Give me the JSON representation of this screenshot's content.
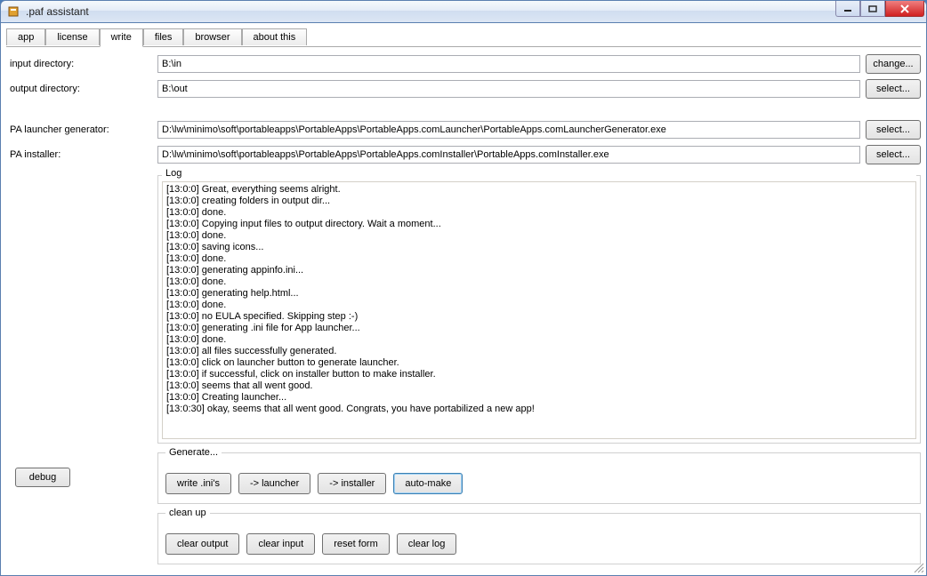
{
  "window": {
    "title": ".paf assistant"
  },
  "tabs": [
    {
      "label": "app"
    },
    {
      "label": "license"
    },
    {
      "label": "write"
    },
    {
      "label": "files"
    },
    {
      "label": "browser"
    },
    {
      "label": "about this"
    }
  ],
  "fields": {
    "input_dir": {
      "label": "input directory:",
      "value": "B:\\in",
      "button": "change..."
    },
    "output_dir": {
      "label": "output directory:",
      "value": "B:\\out",
      "button": "select..."
    },
    "launcher_gen": {
      "label": "PA launcher generator:",
      "value": "D:\\lw\\minimo\\soft\\portableapps\\PortableApps\\PortableApps.comLauncher\\PortableApps.comLauncherGenerator.exe",
      "button": "select..."
    },
    "installer": {
      "label": "PA installer:",
      "value": "D:\\lw\\minimo\\soft\\portableapps\\PortableApps\\PortableApps.comInstaller\\PortableApps.comInstaller.exe",
      "button": "select..."
    }
  },
  "log": {
    "legend": "Log",
    "lines": [
      "[13:0:0] Great, everything seems alright.",
      "[13:0:0] creating folders in output dir...",
      "[13:0:0] done.",
      "[13:0:0] Copying input files to output directory. Wait a moment...",
      "[13:0:0] done.",
      "[13:0:0] saving icons...",
      "[13:0:0] done.",
      "[13:0:0] generating appinfo.ini...",
      "[13:0:0] done.",
      "[13:0:0] generating help.html...",
      "[13:0:0] done.",
      "[13:0:0] no EULA specified. Skipping step :-)",
      "[13:0:0] generating .ini file for App launcher...",
      "[13:0:0] done.",
      "[13:0:0] all files successfully generated.",
      "[13:0:0] click on launcher button to generate launcher.",
      "[13:0:0] if successful, click on installer button to make installer.",
      "[13:0:0] seems that all went good.",
      "[13:0:0] Creating launcher...",
      "[13:0:30] okay, seems that all went good. Congrats, you have portabilized a new app!"
    ]
  },
  "generate": {
    "legend": "Generate...",
    "buttons": {
      "write_inis": "write .ini's",
      "launcher": "-> launcher",
      "installer": "-> installer",
      "automake": "auto-make"
    }
  },
  "cleanup": {
    "legend": "clean up",
    "buttons": {
      "clear_output": "clear output",
      "clear_input": "clear input",
      "reset_form": "reset form",
      "clear_log": "clear log"
    }
  },
  "debug": {
    "label": "debug"
  }
}
